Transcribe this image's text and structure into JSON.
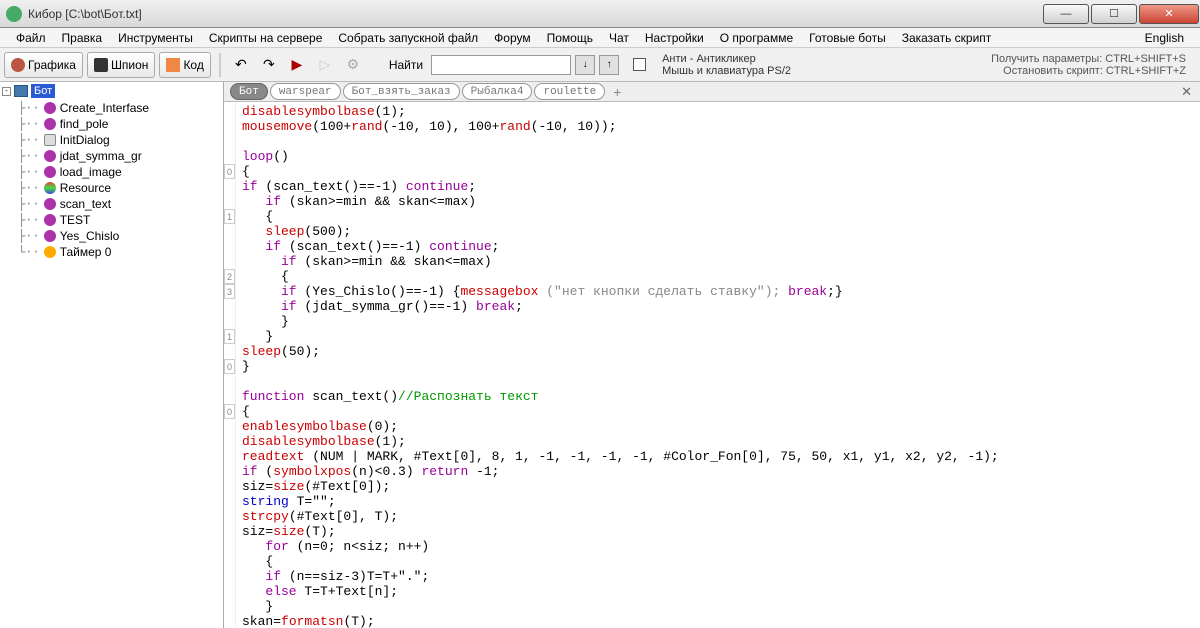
{
  "window": {
    "title": "Кибор  [C:\\bot\\Бот.txt]"
  },
  "menu": {
    "file": "Файл",
    "edit": "Правка",
    "tools": "Инструменты",
    "scripts_server": "Скрипты на сервере",
    "build": "Собрать запускной файл",
    "forum": "Форум",
    "help": "Помощь",
    "chat": "Чат",
    "settings": "Настройки",
    "about": "О программе",
    "ready_bots": "Готовые боты",
    "order": "Заказать скрипт",
    "english": "English"
  },
  "toolbar": {
    "graphics": "Графика",
    "spy": "Шпион",
    "code": "Код",
    "find_label": "Найти",
    "anti_line1": "Анти - Антикликер",
    "anti_line2": "Мышь и клавиатура PS/2",
    "hk_line1": "Получить параметры: CTRL+SHIFT+S",
    "hk_line2": "Остановить скрипт:    CTRL+SHIFT+Z"
  },
  "tree": {
    "root": "Бот",
    "items": [
      {
        "icon": "purple",
        "label": "Create_Interfase"
      },
      {
        "icon": "purple",
        "label": "find_pole"
      },
      {
        "icon": "dlg",
        "label": "InitDialog"
      },
      {
        "icon": "purple",
        "label": "jdat_symma_gr"
      },
      {
        "icon": "purple",
        "label": "load_image"
      },
      {
        "icon": "res",
        "label": "Resource"
      },
      {
        "icon": "purple",
        "label": "scan_text"
      },
      {
        "icon": "purple",
        "label": "TEST"
      },
      {
        "icon": "purple",
        "label": "Yes_Chislo"
      },
      {
        "icon": "timer",
        "label": "Таймер 0"
      }
    ]
  },
  "tabs": {
    "items": [
      "Бот",
      "warspear",
      "Бот_взять_заказ",
      "Рыбалка4",
      "roulette"
    ],
    "active": 0
  },
  "code": {
    "l1a": "disablesymbolbase",
    "l1b": "(1);",
    "l2a": "mousemove",
    "l2b": "(100+",
    "l2c": "rand",
    "l2d": "(-10, 10), 100+",
    "l2e": "rand",
    "l2f": "(-10, 10));",
    "l4a": "loop",
    "l4b": "()",
    "l5": "{",
    "l6a": "if",
    "l6b": " (scan_text()==-1) ",
    "l6c": "continue",
    "l6d": ";",
    "l7a": "   if",
    "l7b": " (skan>=min && skan<=max)",
    "l8": "   {",
    "l9a": "   sleep",
    "l9b": "(500);",
    "l10a": "   if",
    "l10b": " (scan_text()==-1) ",
    "l10c": "continue",
    "l10d": ";",
    "l11a": "     if",
    "l11b": " (skan>=min && skan<=max)",
    "l12": "     {",
    "l13a": "     if",
    "l13b": " (Yes_Chislo()==-1) {",
    "l13c": "messagebox",
    "l13d": " (\"нет кнопки сделать ставку\"); ",
    "l13e": "break",
    "l13f": ";}",
    "l14a": "     if",
    "l14b": " (jdat_symma_gr()==-1) ",
    "l14c": "break",
    "l14d": ";",
    "l15": "     }",
    "l16": "   }",
    "l17a": "sleep",
    "l17b": "(50);",
    "l18": "}",
    "l20a": "function",
    "l20b": " scan_text()",
    "l20c": "//Распознать текст",
    "l21": "{",
    "l22a": "enablesymbolbase",
    "l22b": "(0);",
    "l23a": "disablesymbolbase",
    "l23b": "(1);",
    "l24a": "readtext",
    "l24b": " (NUM | MARK, #Text[0], 8, 1, -1, -1, -1, -1, #Color_Fon[0], 75, 50, x1, y1, x2, y2, -1);",
    "l25a": "if",
    "l25b": " (",
    "l25c": "symbolxpos",
    "l25d": "(n)<0.3) ",
    "l25e": "return",
    "l25f": " -1;",
    "l26a": "siz=",
    "l26b": "size",
    "l26c": "(#Text[0]);",
    "l27a": "string",
    "l27b": " T=\"\";",
    "l28a": "strcpy",
    "l28b": "(#Text[0], T);",
    "l29a": "siz=",
    "l29b": "size",
    "l29c": "(T);",
    "l30a": "   for",
    "l30b": " (n=0; n<siz; n++)",
    "l31": "   {",
    "l32a": "   if",
    "l32b": " (n==siz-3)T=T+\".\";",
    "l33a": "   else",
    "l33b": " T=T+Text[n];",
    "l34": "   }",
    "l35a": "skan=",
    "l35b": "formatsn",
    "l35c": "(T);"
  }
}
